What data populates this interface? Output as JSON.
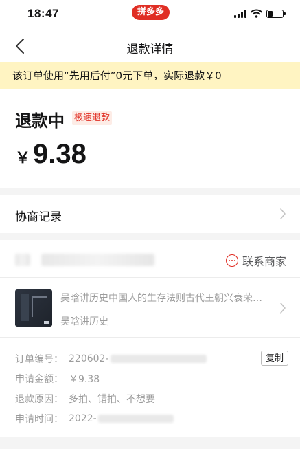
{
  "status_bar": {
    "time": "18:47",
    "app_badge": "拼多多"
  },
  "nav": {
    "title": "退款详情"
  },
  "notice": {
    "text": "该订单使用“先用后付”0元下单，实际退款￥0"
  },
  "refund": {
    "status": "退款中",
    "tag": "极速退款",
    "currency_symbol": "￥",
    "amount": "9.38"
  },
  "negotiation": {
    "label": "协商记录"
  },
  "store": {
    "contact_label": "联系商家"
  },
  "product": {
    "title": "吴晗讲历史中国人的生存法则古代王朝兴衰荣…",
    "spec": "吴晗讲历史"
  },
  "order_info": {
    "order_no_label": "订单编号：",
    "order_no_value": "220602-",
    "copy_label": "复制",
    "amount_label": "申请金额：",
    "amount_value": "￥9.38",
    "reason_label": "退款原因：",
    "reason_value": "多拍、错拍、不想要",
    "time_label": "申请时间：",
    "time_value": "2022-"
  },
  "colors": {
    "brand_red": "#e02e24",
    "notice_bg": "#fff4c2",
    "tag_bg": "#fdece6",
    "muted_text": "#9c9c9c"
  },
  "icons": [
    "back-arrow-icon",
    "chevron-right-icon",
    "chat-bubble-icon",
    "signal-icon",
    "wifi-icon",
    "battery-icon"
  ]
}
